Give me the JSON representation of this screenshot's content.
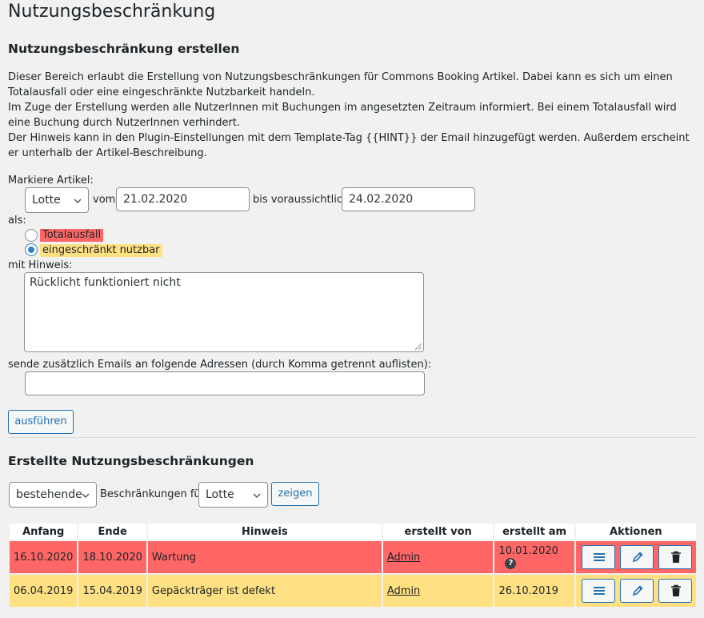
{
  "page": {
    "title": "Nutzungsbeschränkung"
  },
  "create": {
    "heading": "Nutzungsbeschränkung erstellen",
    "desc1": "Dieser Bereich erlaubt die Erstellung von Nutzungsbeschränkungen für Commons Booking Artikel. Dabei kann es sich um einen Totalausfall oder eine eingeschränkte Nutzbarkeit handeln.",
    "desc2": "Im Zuge der Erstellung werden alle NutzerInnen mit Buchungen im angesetzten Zeitraum informiert. Bei einem Totalausfall wird eine Buchung durch NutzerInnen verhindert.",
    "desc3": "Der Hinweis kann in den Plugin-Einstellungen mit dem Template-Tag {{HINT}} der Email hinzugefügt werden. Außerdem erscheint er unterhalb der Artikel-Beschreibung.",
    "mark_label": "Markiere Artikel:",
    "item_value": "Lotte",
    "from_label": "vom",
    "from_value": "21.02.2020",
    "until_label": "bis voraussichtlich",
    "until_value": "24.02.2020",
    "as_label": "als:",
    "option_total": "Totalausfall",
    "option_limited": "eingeschränkt nutzbar",
    "selected_option": "eingeschränkt nutzbar",
    "hint_label": "mit Hinweis:",
    "hint_value": "Rücklicht funktioniert nicht",
    "emails_label": "sende zusätzlich Emails an folgende Adressen (durch Komma getrennt auflisten):",
    "emails_value": "",
    "submit_label": "ausführen"
  },
  "list": {
    "heading": "Erstellte Nutzungsbeschränkungen",
    "status_filter": "bestehende",
    "for_label": "Beschränkungen für",
    "item_filter": "Lotte",
    "show_label": "zeigen",
    "columns": [
      "Anfang",
      "Ende",
      "Hinweis",
      "erstellt von",
      "erstellt am",
      "Aktionen"
    ],
    "rows": [
      {
        "start": "16.10.2020",
        "end": "18.10.2020",
        "hint": "Wartung",
        "created_by": "Admin",
        "created_at": "10.01.2020",
        "help": "?",
        "type": "Totalausfall"
      },
      {
        "start": "06.04.2019",
        "end": "15.04.2019",
        "hint": "Gepäckträger ist defekt",
        "created_by": "Admin",
        "created_at": "26.10.2019",
        "help": "",
        "type": "eingeschränkt nutzbar"
      }
    ]
  },
  "colors": {
    "total": "#ff6666",
    "limited": "#ffe082",
    "accent": "#2271b1",
    "background": "#f1f1f1"
  },
  "icons": {
    "details": "list-icon",
    "edit": "pencil-icon",
    "delete": "trash-icon"
  }
}
